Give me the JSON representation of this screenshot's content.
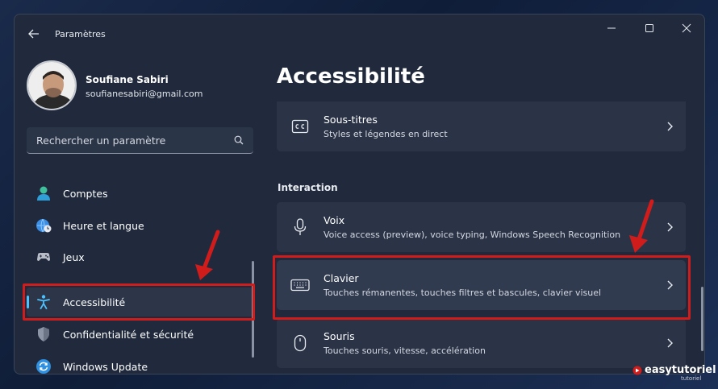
{
  "window": {
    "title": "Paramètres",
    "controls": [
      "minimize-icon",
      "maximize-icon",
      "close-icon"
    ]
  },
  "user": {
    "name": "Soufiane Sabiri",
    "email": "soufianesabiri@gmail.com"
  },
  "search": {
    "placeholder": "Rechercher un paramètre"
  },
  "sidebar": {
    "items": [
      {
        "label": "Comptes",
        "icon": "person-icon"
      },
      {
        "label": "Heure et langue",
        "icon": "globe-clock-icon"
      },
      {
        "label": "Jeux",
        "icon": "gamepad-icon"
      },
      {
        "label": "Accessibilité",
        "icon": "accessibility-icon",
        "active": true
      },
      {
        "label": "Confidentialité et sécurité",
        "icon": "shield-icon"
      },
      {
        "label": "Windows Update",
        "icon": "update-icon"
      }
    ]
  },
  "main": {
    "title": "Accessibilité",
    "section_interaction": "Interaction",
    "cards": [
      {
        "title": "Sous-titres",
        "subtitle": "Styles et légendes en direct",
        "icon": "captions-icon"
      },
      {
        "title": "Voix",
        "subtitle": "Voice access (preview), voice typing, Windows Speech Recognition",
        "icon": "microphone-icon"
      },
      {
        "title": "Clavier",
        "subtitle": "Touches rémanentes, touches filtres et bascules, clavier visuel",
        "icon": "keyboard-icon"
      },
      {
        "title": "Souris",
        "subtitle": "Touches souris, vitesse, accélération",
        "icon": "mouse-icon"
      }
    ]
  },
  "watermark": {
    "text": "easytutoriel",
    "sub": "tutoriel"
  },
  "colors": {
    "accent": "#4cc2ff",
    "highlight": "#d11c1c",
    "window_bg": "#202a3c",
    "card_bg": "#2b3447"
  }
}
